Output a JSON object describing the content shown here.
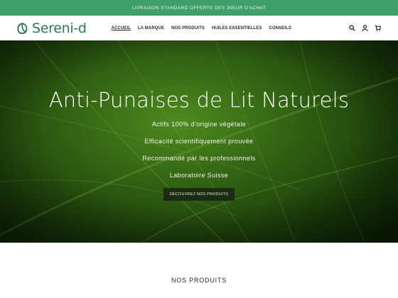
{
  "announcement": "LIVRAISON STANDARD OFFERTE DES 35EUR D'ACHAT",
  "logo": {
    "text": "Sereni-d",
    "color": "#2e7a55"
  },
  "nav": [
    "ACCUEIL",
    "LA MARQUE",
    "NOS PRODUITS",
    "HUILES ESSENTIELLES",
    "CONSEILS"
  ],
  "icons": {
    "search": "search-icon",
    "account": "user-icon",
    "cart": "cart-icon"
  },
  "hero": {
    "title": "Anti-Punaises de Lit Naturels",
    "lines": [
      "Actifs 100% d'origine végétale",
      "Efficacité scientifiquement prouvée",
      "Recommandé par les professionnels",
      "Laboratoire Suisse"
    ],
    "cta": "DECOUVREZ NOS PRODUITS"
  },
  "section_title": "NOS PRODUITS",
  "colors": {
    "announce_bg": "#3f9e6a",
    "brand": "#2e7a55"
  }
}
